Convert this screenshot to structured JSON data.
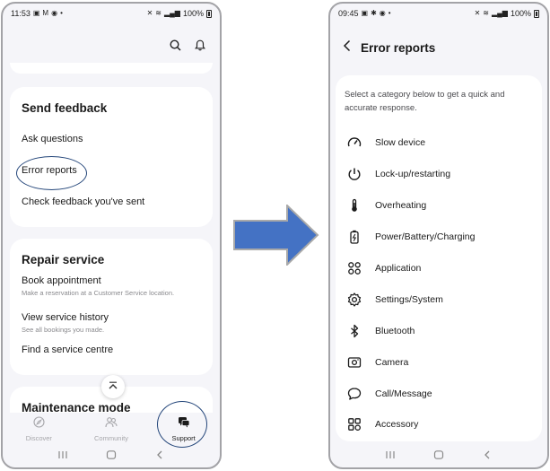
{
  "left_screen": {
    "status_bar": {
      "time": "11:53",
      "battery": "100%",
      "notif_icons": [
        "gallery-icon",
        "gmail-icon",
        "vpn-icon"
      ]
    },
    "send_feedback": {
      "title": "Send feedback",
      "items": [
        {
          "label": "Ask questions"
        },
        {
          "label": "Error reports"
        },
        {
          "label": "Check feedback you've sent"
        }
      ]
    },
    "repair_service": {
      "title": "Repair service",
      "items": [
        {
          "label": "Book appointment",
          "subtitle": "Make a reservation at a Customer Service location."
        },
        {
          "label": "View service history",
          "subtitle": "See all bookings you made."
        },
        {
          "label": "Find a service centre",
          "subtitle": ""
        }
      ]
    },
    "maintenance": {
      "title": "Maintenance mode"
    },
    "bottom_nav": {
      "tabs": [
        {
          "label": "Discover",
          "icon": "compass-icon",
          "active": false
        },
        {
          "label": "Community",
          "icon": "people-icon",
          "active": false
        },
        {
          "label": "Support",
          "icon": "chat-icon",
          "active": true
        }
      ]
    }
  },
  "right_screen": {
    "status_bar": {
      "time": "09:45",
      "battery": "100%",
      "notif_icons": [
        "gallery-icon",
        "settings-icon",
        "vpn-icon"
      ]
    },
    "header": {
      "title": "Error reports"
    },
    "intro": "Select a category below to get a quick and accurate response.",
    "categories": [
      {
        "label": "Slow device",
        "icon": "speedometer-icon"
      },
      {
        "label": "Lock-up/restarting",
        "icon": "power-icon"
      },
      {
        "label": "Overheating",
        "icon": "thermometer-icon"
      },
      {
        "label": "Power/Battery/Charging",
        "icon": "battery-icon"
      },
      {
        "label": "Application",
        "icon": "apps-icon"
      },
      {
        "label": "Settings/System",
        "icon": "gear-icon"
      },
      {
        "label": "Bluetooth",
        "icon": "bluetooth-icon"
      },
      {
        "label": "Camera",
        "icon": "camera-icon"
      },
      {
        "label": "Call/Message",
        "icon": "speech-bubble-icon"
      },
      {
        "label": "Accessory",
        "icon": "accessory-icon"
      }
    ]
  },
  "colors": {
    "arrow": "#4472c4",
    "highlight": "#24467a",
    "background": "#f5f5f9"
  }
}
